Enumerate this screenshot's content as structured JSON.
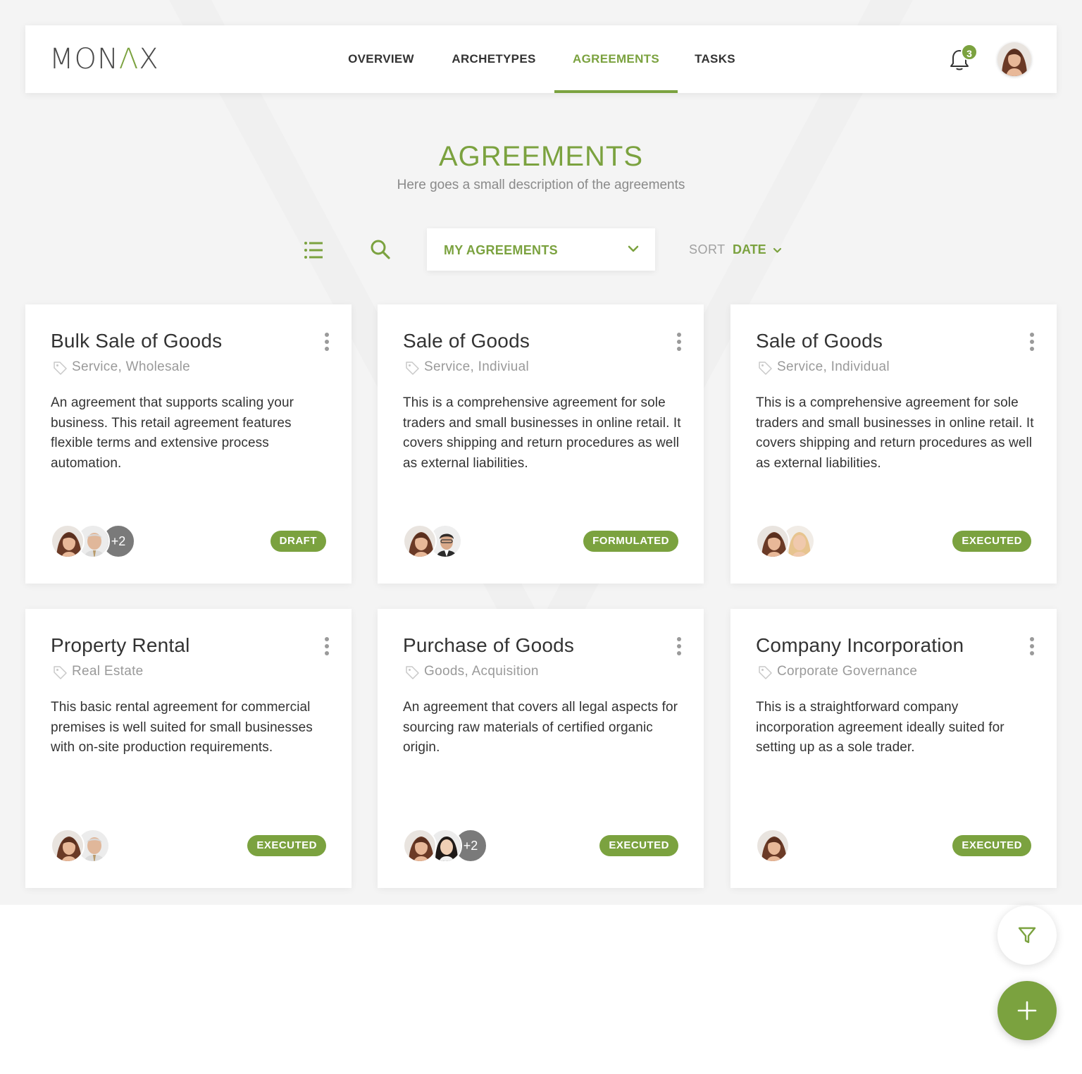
{
  "brand": {
    "logo_pre": "MON",
    "logo_a": "Λ",
    "logo_post": "X",
    "accent": "#7ba23f"
  },
  "nav": {
    "items": [
      {
        "label": "OVERVIEW"
      },
      {
        "label": "ARCHETYPES"
      },
      {
        "label": "AGREEMENTS",
        "active": true
      },
      {
        "label": "TASKS"
      }
    ],
    "notifications_count": "3"
  },
  "page": {
    "title": "AGREEMENTS",
    "subtitle": "Here goes a small description of the agreements"
  },
  "toolbar": {
    "view_icon": "list-icon",
    "search_icon": "search-icon",
    "filter_select": "MY AGREEMENTS",
    "sort_label": "SORT",
    "sort_value": "DATE"
  },
  "cards": [
    {
      "title": "Bulk Sale of Goods",
      "tags": "Service, Wholesale",
      "description": "An agreement that supports scaling your business. This retail agreement features flexible terms and extensive process automation.",
      "extra_parties": "+2",
      "status": "DRAFT"
    },
    {
      "title": "Sale of Goods",
      "tags": "Service, Indiviual",
      "description": "This is a comprehensive agreement for sole traders and small businesses in online retail. It covers shipping and return procedures as well as external liabilities.",
      "extra_parties": "",
      "status": "FORMULATED"
    },
    {
      "title": "Sale of Goods",
      "tags": "Service, Individual",
      "description": "This is a comprehensive agreement for sole traders and small businesses in online retail. It covers shipping and return procedures as well as external liabilities.",
      "extra_parties": "",
      "status": "EXECUTED"
    },
    {
      "title": "Property Rental",
      "tags": "Real Estate",
      "description": "This basic rental agreement for commercial premises is well suited for small businesses with on-site production requirements.",
      "extra_parties": "",
      "status": "EXECUTED"
    },
    {
      "title": "Purchase of Goods",
      "tags": "Goods, Acquisition",
      "description": "An agreement that covers all legal aspects for sourcing raw materials of certified organic origin.",
      "extra_parties": "+2",
      "status": "EXECUTED"
    },
    {
      "title": "Company Incorporation",
      "tags": "Corporate Governance",
      "description": "This is a straightforward company incorporation agreement ideally suited for setting up as a sole trader.",
      "extra_parties": "",
      "status": "EXECUTED"
    }
  ],
  "fabs": {
    "filter_icon": "filter-icon",
    "add_icon": "plus-icon"
  }
}
